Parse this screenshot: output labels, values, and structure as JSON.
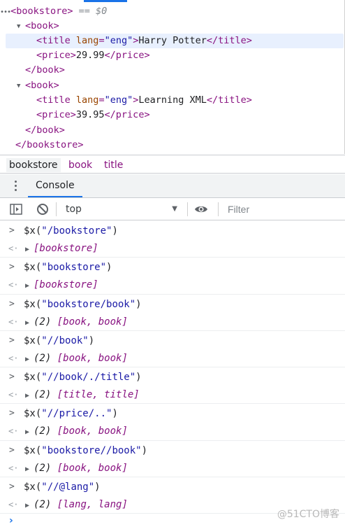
{
  "elements": {
    "selected_ref": "== $0",
    "lines": {
      "root_open": "<bookstore>",
      "book1_open": "<book>",
      "book1_title_open": "<title",
      "book1_title_attr": "lang",
      "book1_title_val": "\"eng\"",
      "book1_title_text": "Harry Potter",
      "book1_title_close": "</title>",
      "book1_price_open": "<price>",
      "book1_price_text": "29.99",
      "book1_price_close": "</price>",
      "book1_close": "</book>",
      "book2_open": "<book>",
      "book2_title_open": "<title",
      "book2_title_attr": "lang",
      "book2_title_val": "\"eng\"",
      "book2_title_text": "Learning XML",
      "book2_title_close": "</title>",
      "book2_price_open": "<price>",
      "book2_price_text": "39.95",
      "book2_price_close": "</price>",
      "book2_close": "</book>",
      "root_close": "</bookstore>"
    }
  },
  "breadcrumb": [
    "bookstore",
    "book",
    "title"
  ],
  "drawer": {
    "tab_label": "Console"
  },
  "toolbar": {
    "context": "top",
    "filter_placeholder": "Filter"
  },
  "console": {
    "entries": [
      {
        "pre": "$x(",
        "arg": "\"/bookstore\"",
        "post": ")",
        "count": "",
        "result": "[bookstore]"
      },
      {
        "pre": "$x(",
        "arg": "\"bookstore\"",
        "post": ")",
        "count": "",
        "result": "[bookstore]"
      },
      {
        "pre": "$x(",
        "arg": "\"bookstore/book\"",
        "post": ")",
        "count": "(2)",
        "result": "[book, book]"
      },
      {
        "pre": "$x(",
        "arg": "\"//book\"",
        "post": ")",
        "count": "(2)",
        "result": "[book, book]"
      },
      {
        "pre": "$x(",
        "arg": "\"//book/./title\"",
        "post": ")",
        "count": "(2)",
        "result": "[title, title]"
      },
      {
        "pre": "$x(",
        "arg": "\"//price/..\"",
        "post": ")",
        "count": "(2)",
        "result": "[book, book]"
      },
      {
        "pre": "$x(",
        "arg": "\"bookstore//book\"",
        "post": ")",
        "count": "(2)",
        "result": "[book, book]"
      },
      {
        "pre": "$x(",
        "arg": "\"//@lang\"",
        "post": ")",
        "count": "(2)",
        "result": "[lang, lang]"
      }
    ]
  },
  "watermark": "@51CTO博客",
  "colors": {
    "accent": "#1a73e8",
    "tag": "#881280",
    "attr_value": "#1a1aa6",
    "attr_name": "#994500"
  }
}
